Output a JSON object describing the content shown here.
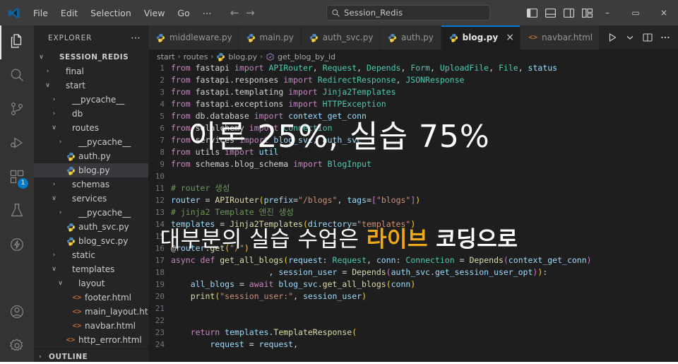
{
  "window": {
    "app_icon": "vscode-logo-icon",
    "menus": [
      "File",
      "Edit",
      "Selection",
      "View",
      "Go",
      "⋯"
    ],
    "nav_back": "←",
    "nav_forward": "→",
    "search": {
      "value": "Session_Redis",
      "icon": "search-icon"
    },
    "layout_icons": [
      "toggle-primary-sidebar-icon",
      "toggle-panel-icon",
      "toggle-secondary-sidebar-icon",
      "customize-layout-icon"
    ],
    "controls": {
      "minimize": "–",
      "maximize": "▭",
      "close": "×"
    }
  },
  "activitybar": {
    "items": [
      {
        "name": "explorer-icon",
        "label": "Explorer",
        "active": true,
        "badge": null
      },
      {
        "name": "search-icon",
        "label": "Search",
        "active": false,
        "badge": null
      },
      {
        "name": "source-control-icon",
        "label": "Source Control",
        "active": false,
        "badge": null
      },
      {
        "name": "run-and-debug-icon",
        "label": "Run and Debug",
        "active": false,
        "badge": null
      },
      {
        "name": "extensions-icon",
        "label": "Extensions",
        "active": false,
        "badge": "1"
      },
      {
        "name": "testing-flask-icon",
        "label": "Testing",
        "active": false,
        "badge": null
      },
      {
        "name": "lightning-icon",
        "label": "Thunder Client",
        "active": false,
        "badge": null
      }
    ],
    "bottom": [
      {
        "name": "account-icon",
        "label": "Accounts"
      },
      {
        "name": "settings-gear-icon",
        "label": "Manage"
      }
    ]
  },
  "sidebar": {
    "header": {
      "title": "EXPLORER",
      "more": "⋯"
    },
    "outline": {
      "label": "OUTLINE",
      "chevron": "›"
    },
    "tree": [
      {
        "label": "SESSION_REDIS",
        "depth": 0,
        "type": "root",
        "chevron": "∨",
        "selected": false
      },
      {
        "label": "final",
        "depth": 1,
        "type": "folder",
        "chevron": "›",
        "selected": false
      },
      {
        "label": "start",
        "depth": 1,
        "type": "folder",
        "chevron": "∨",
        "selected": false
      },
      {
        "label": "__pycache__",
        "depth": 2,
        "type": "folder",
        "chevron": "›",
        "selected": false
      },
      {
        "label": "db",
        "depth": 2,
        "type": "folder",
        "chevron": "›",
        "selected": false
      },
      {
        "label": "routes",
        "depth": 2,
        "type": "folder",
        "chevron": "∨",
        "selected": false
      },
      {
        "label": "__pycache__",
        "depth": 3,
        "type": "folder",
        "chevron": "›",
        "selected": false
      },
      {
        "label": "auth.py",
        "depth": 3,
        "type": "python",
        "chevron": "",
        "selected": false
      },
      {
        "label": "blog.py",
        "depth": 3,
        "type": "python",
        "chevron": "",
        "selected": true
      },
      {
        "label": "schemas",
        "depth": 2,
        "type": "folder",
        "chevron": "›",
        "selected": false
      },
      {
        "label": "services",
        "depth": 2,
        "type": "folder",
        "chevron": "∨",
        "selected": false
      },
      {
        "label": "__pycache__",
        "depth": 3,
        "type": "folder",
        "chevron": "›",
        "selected": false
      },
      {
        "label": "auth_svc.py",
        "depth": 3,
        "type": "python",
        "chevron": "",
        "selected": false
      },
      {
        "label": "blog_svc.py",
        "depth": 3,
        "type": "python",
        "chevron": "",
        "selected": false
      },
      {
        "label": "static",
        "depth": 2,
        "type": "folder",
        "chevron": "›",
        "selected": false
      },
      {
        "label": "templates",
        "depth": 2,
        "type": "folder",
        "chevron": "∨",
        "selected": false
      },
      {
        "label": "layout",
        "depth": 3,
        "type": "folder",
        "chevron": "∨",
        "selected": false
      },
      {
        "label": "footer.html",
        "depth": 4,
        "type": "html",
        "chevron": "",
        "selected": false
      },
      {
        "label": "main_layout.html",
        "depth": 4,
        "type": "html",
        "chevron": "",
        "selected": false
      },
      {
        "label": "navbar.html",
        "depth": 4,
        "type": "html",
        "chevron": "",
        "selected": false
      },
      {
        "label": "http_error.html",
        "depth": 3,
        "type": "html",
        "chevron": "",
        "selected": false
      }
    ]
  },
  "tabs": {
    "items": [
      {
        "label": "middleware.py",
        "type": "python",
        "active": false,
        "closable": false
      },
      {
        "label": "main.py",
        "type": "python",
        "active": false,
        "closable": false
      },
      {
        "label": "auth_svc.py",
        "type": "python",
        "active": false,
        "closable": false
      },
      {
        "label": "auth.py",
        "type": "python",
        "active": false,
        "closable": false
      },
      {
        "label": "blog.py",
        "type": "python",
        "active": true,
        "closable": true,
        "close": "×"
      },
      {
        "label": "navbar.html",
        "type": "html",
        "active": false,
        "closable": false
      }
    ],
    "actions": [
      "run-python-file-icon",
      "chevron-down-icon",
      "split-editor-icon",
      "more-actions-icon"
    ]
  },
  "breadcrumb": {
    "parts": [
      "start",
      "routes",
      "blog.py",
      "get_blog_by_id"
    ],
    "separator": "›",
    "file_icon": "python-icon",
    "symbol_icon": "symbol-method-icon"
  },
  "editor": {
    "lines": [
      {
        "n": 1,
        "tokens": [
          [
            "k",
            "from "
          ],
          [
            "p",
            "fastapi "
          ],
          [
            "k",
            "import "
          ],
          [
            "n",
            "APIRouter"
          ],
          [
            "p",
            ", "
          ],
          [
            "n",
            "Request"
          ],
          [
            "p",
            ", "
          ],
          [
            "n",
            "Depends"
          ],
          [
            "p",
            ", "
          ],
          [
            "n",
            "Form"
          ],
          [
            "p",
            ", "
          ],
          [
            "n",
            "UploadFile"
          ],
          [
            "p",
            ", "
          ],
          [
            "n",
            "File"
          ],
          [
            "p",
            ", "
          ],
          [
            "v",
            "status"
          ]
        ]
      },
      {
        "n": 2,
        "tokens": [
          [
            "k",
            "from "
          ],
          [
            "p",
            "fastapi.responses "
          ],
          [
            "k",
            "import "
          ],
          [
            "n",
            "RedirectResponse"
          ],
          [
            "p",
            ", "
          ],
          [
            "n",
            "JSONResponse"
          ]
        ]
      },
      {
        "n": 3,
        "tokens": [
          [
            "k",
            "from "
          ],
          [
            "p",
            "fastapi.templating "
          ],
          [
            "k",
            "import "
          ],
          [
            "n",
            "Jinja2Templates"
          ]
        ]
      },
      {
        "n": 4,
        "tokens": [
          [
            "k",
            "from "
          ],
          [
            "p",
            "fastapi.exceptions "
          ],
          [
            "k",
            "import "
          ],
          [
            "n",
            "HTTPException"
          ]
        ]
      },
      {
        "n": 5,
        "tokens": [
          [
            "k",
            "from "
          ],
          [
            "p",
            "db.database "
          ],
          [
            "k",
            "import "
          ],
          [
            "v",
            "context_get_conn"
          ]
        ]
      },
      {
        "n": 6,
        "tokens": [
          [
            "k",
            "from "
          ],
          [
            "p",
            "sqlalchemy "
          ],
          [
            "k",
            "import "
          ],
          [
            "n",
            "Connection"
          ]
        ]
      },
      {
        "n": 7,
        "tokens": [
          [
            "k",
            "from "
          ],
          [
            "p",
            "services "
          ],
          [
            "k",
            "import "
          ],
          [
            "v",
            "blog_svc"
          ],
          [
            "p",
            ", "
          ],
          [
            "v",
            "auth_svc"
          ]
        ]
      },
      {
        "n": 8,
        "tokens": [
          [
            "k",
            "from "
          ],
          [
            "p",
            "utils "
          ],
          [
            "k",
            "import "
          ],
          [
            "v",
            "util"
          ]
        ]
      },
      {
        "n": 9,
        "tokens": [
          [
            "k",
            "from "
          ],
          [
            "p",
            "schemas.blog_schema "
          ],
          [
            "k",
            "import "
          ],
          [
            "n",
            "BlogInput"
          ]
        ]
      },
      {
        "n": 10,
        "tokens": []
      },
      {
        "n": 11,
        "tokens": [
          [
            "c",
            "# router 생성"
          ]
        ]
      },
      {
        "n": 12,
        "tokens": [
          [
            "v",
            "router "
          ],
          [
            "p",
            "= "
          ],
          [
            "f",
            "APIRouter"
          ],
          [
            "y",
            "("
          ],
          [
            "v",
            "prefix"
          ],
          [
            "p",
            "="
          ],
          [
            "s",
            "\"/blogs\""
          ],
          [
            "p",
            ", "
          ],
          [
            "v",
            "tags"
          ],
          [
            "p",
            "="
          ],
          [
            "y2",
            "["
          ],
          [
            "s",
            "\"blogs\""
          ],
          [
            "y2",
            "]"
          ],
          [
            "y",
            ")"
          ]
        ]
      },
      {
        "n": 13,
        "tokens": [
          [
            "c",
            "# jinja2 Template 엔진 생성"
          ]
        ]
      },
      {
        "n": 14,
        "tokens": [
          [
            "v",
            "templates "
          ],
          [
            "p",
            "= "
          ],
          [
            "f",
            "Jinja2Templates"
          ],
          [
            "y",
            "("
          ],
          [
            "v",
            "directory"
          ],
          [
            "p",
            "="
          ],
          [
            "s",
            "\"templates\""
          ],
          [
            "y",
            ")"
          ]
        ]
      },
      {
        "n": 15,
        "tokens": []
      },
      {
        "n": 16,
        "tokens": [
          [
            "p",
            "@"
          ],
          [
            "v",
            "router"
          ],
          [
            "p",
            "."
          ],
          [
            "f",
            "get"
          ],
          [
            "y",
            "("
          ],
          [
            "s",
            "\"/\""
          ],
          [
            "y",
            ")"
          ]
        ]
      },
      {
        "n": 17,
        "tokens": [
          [
            "k",
            "async "
          ],
          [
            "k",
            "def "
          ],
          [
            "f",
            "get_all_blogs"
          ],
          [
            "y",
            "("
          ],
          [
            "v",
            "request"
          ],
          [
            "p",
            ": "
          ],
          [
            "n",
            "Request"
          ],
          [
            "p",
            ", "
          ],
          [
            "v",
            "conn"
          ],
          [
            "p",
            ": "
          ],
          [
            "n",
            "Connection "
          ],
          [
            "p",
            "= "
          ],
          [
            "f",
            "Depends"
          ],
          [
            "y2",
            "("
          ],
          [
            "v",
            "context_get_conn"
          ],
          [
            "y2",
            ")"
          ]
        ]
      },
      {
        "n": 18,
        "tokens": [
          [
            "p",
            "                    , "
          ],
          [
            "v",
            "session_user "
          ],
          [
            "p",
            "= "
          ],
          [
            "f",
            "Depends"
          ],
          [
            "y2",
            "("
          ],
          [
            "v",
            "auth_svc"
          ],
          [
            "p",
            "."
          ],
          [
            "v",
            "get_session_user_opt"
          ],
          [
            "y2",
            ")"
          ],
          [
            "y",
            ")"
          ],
          [
            "p",
            ":"
          ]
        ]
      },
      {
        "n": 19,
        "tokens": [
          [
            "v",
            "    all_blogs "
          ],
          [
            "p",
            "= "
          ],
          [
            "k",
            "await "
          ],
          [
            "v",
            "blog_svc"
          ],
          [
            "p",
            "."
          ],
          [
            "f",
            "get_all_blogs"
          ],
          [
            "y",
            "("
          ],
          [
            "v",
            "conn"
          ],
          [
            "y",
            ")"
          ]
        ]
      },
      {
        "n": 20,
        "tokens": [
          [
            "f",
            "    print"
          ],
          [
            "y",
            "("
          ],
          [
            "s",
            "\"session_user:\""
          ],
          [
            "p",
            ", "
          ],
          [
            "v",
            "session_user"
          ],
          [
            "y",
            ")"
          ]
        ]
      },
      {
        "n": 21,
        "tokens": []
      },
      {
        "n": 22,
        "tokens": []
      },
      {
        "n": 23,
        "tokens": [
          [
            "k",
            "    return "
          ],
          [
            "v",
            "templates"
          ],
          [
            "p",
            "."
          ],
          [
            "f",
            "TemplateResponse"
          ],
          [
            "y",
            "("
          ]
        ]
      },
      {
        "n": 24,
        "tokens": [
          [
            "v",
            "        request "
          ],
          [
            "p",
            "= "
          ],
          [
            "v",
            "request"
          ],
          [
            "p",
            ","
          ]
        ]
      }
    ]
  },
  "overlays": {
    "line1": "이론 25%, 실습 75%",
    "line2_pre": "대부분의 실습 수업은 ",
    "line2_accent": "라이브",
    "line2_post": " 코딩으로",
    "accent_color": "#f0a818",
    "text_color": "#ffffff"
  }
}
